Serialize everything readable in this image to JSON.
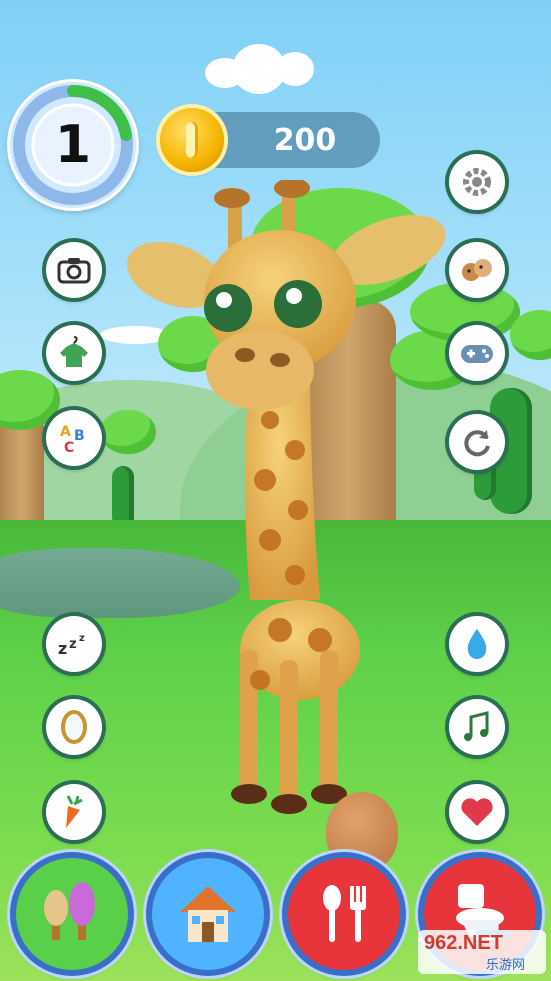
{
  "hud": {
    "level": "1",
    "level_progress": 0.22,
    "coins": "200"
  },
  "left_buttons": [
    {
      "icon": "camera-icon"
    },
    {
      "icon": "shirt-hanger-icon"
    },
    {
      "icon": "abc-blocks-icon"
    },
    {
      "icon": "sleep-zzz-icon"
    },
    {
      "icon": "mirror-icon"
    },
    {
      "icon": "carrot-icon"
    }
  ],
  "right_buttons": [
    {
      "icon": "gear-icon"
    },
    {
      "icon": "pets-friends-icon"
    },
    {
      "icon": "gamepad-icon"
    },
    {
      "icon": "refresh-icon"
    },
    {
      "icon": "water-drop-icon"
    },
    {
      "icon": "music-note-icon"
    },
    {
      "icon": "heart-icon"
    }
  ],
  "bottom_nav": [
    {
      "icon": "garden-trees-icon",
      "color": "#5ad04a"
    },
    {
      "icon": "house-icon",
      "color": "#4fb3ff"
    },
    {
      "icon": "fork-spoon-icon",
      "color": "#e8353b"
    },
    {
      "icon": "toilet-icon",
      "color": "#e8353b"
    }
  ],
  "watermark": {
    "main": "962.NET",
    "sub": "乐游网"
  },
  "colors": {
    "button_ring": "#2a6f53",
    "level_ring": "#3fbf4a",
    "coin": "#f5b300"
  }
}
